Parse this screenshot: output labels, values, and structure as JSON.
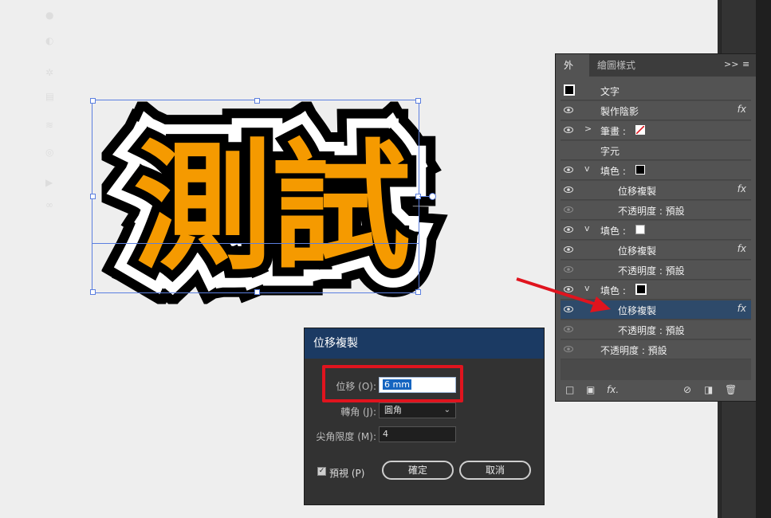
{
  "artwork": {
    "text": "測試"
  },
  "appearance_panel": {
    "tabs": [
      "外觀",
      "繪圖樣式"
    ],
    "menu_glyph": ">>",
    "rows": [
      {
        "label": "文字",
        "type": "object"
      },
      {
        "label": "製作陰影",
        "fx": "fx"
      },
      {
        "label": "筆畫 :",
        "swatch": "none",
        "chevron": ">"
      },
      {
        "label": "字元"
      },
      {
        "label": "填色 :",
        "swatch": "black",
        "chevron": "v"
      },
      {
        "label": "位移複製",
        "fx": "fx"
      },
      {
        "label": "不透明度 : 預設"
      },
      {
        "label": "填色 :",
        "swatch": "white",
        "chevron": "v"
      },
      {
        "label": "位移複製",
        "fx": "fx"
      },
      {
        "label": "不透明度 : 預設"
      },
      {
        "label": "填色 :",
        "swatch": "outline",
        "chevron": "v"
      },
      {
        "label": "位移複製",
        "fx": "fx",
        "selected": true
      },
      {
        "label": "不透明度 : 預設"
      },
      {
        "label": "不透明度 : 預設"
      }
    ]
  },
  "dialog": {
    "title": "位移複製",
    "offset_label": "位移 (O):",
    "offset_value": "6 mm",
    "joins_label": "轉角 (J):",
    "joins_value": "圓角",
    "miter_label": "尖角限度 (M):",
    "miter_value": "4",
    "preview_label": "預視 (P)",
    "preview_checked": true,
    "ok_label": "確定",
    "cancel_label": "取消"
  },
  "colors": {
    "art_fill": "#f59a00",
    "dialog_title_bar": "#1b3a63",
    "highlight_box": "#e0141e",
    "selected_row": "#2e4a6a"
  }
}
